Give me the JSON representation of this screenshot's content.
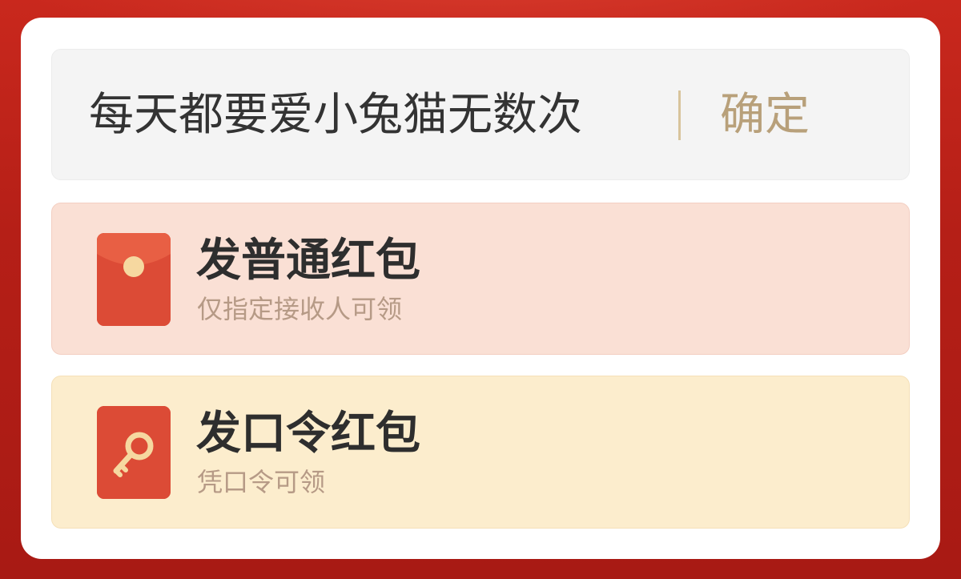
{
  "message": {
    "text": "每天都要爱小兔猫无数次",
    "confirm_label": "确定"
  },
  "options": [
    {
      "title": "发普通红包",
      "subtitle": "仅指定接收人可领",
      "icon": "red-envelope-icon"
    },
    {
      "title": "发口令红包",
      "subtitle": "凭口令可领",
      "icon": "key-icon"
    }
  ],
  "colors": {
    "background": "#b51f17",
    "confirm": "#b8a07a",
    "normal_option_bg": "#fae0d5",
    "password_option_bg": "#fcedcd",
    "icon_red": "#d94a35"
  }
}
